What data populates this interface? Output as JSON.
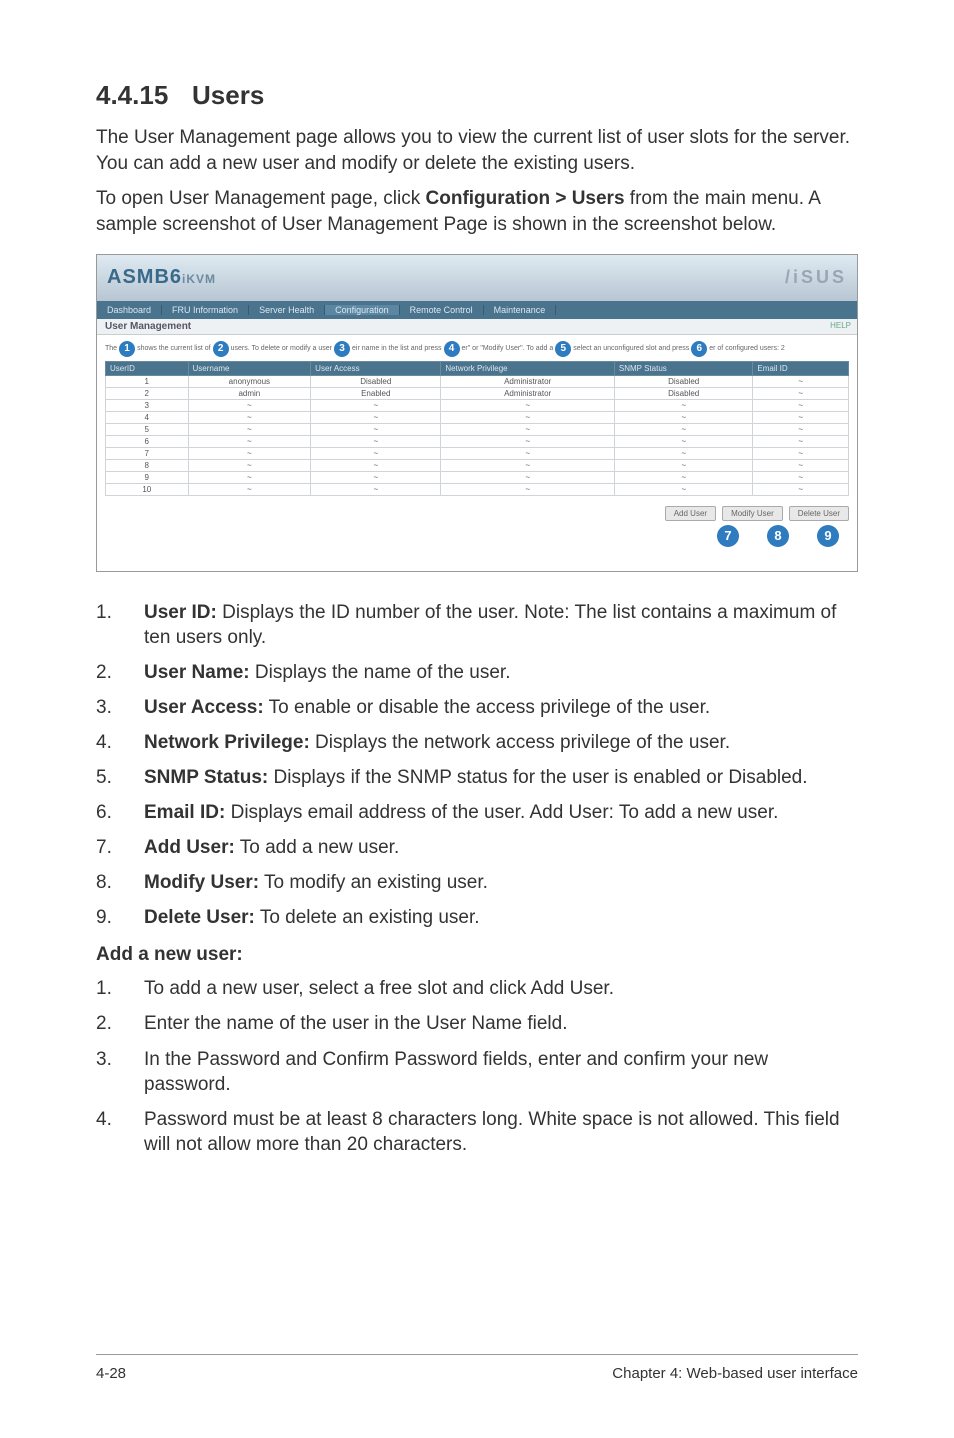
{
  "section_number": "4.4.15",
  "section_title": "Users",
  "intro_p1": "The User Management page allows you to view the current list of user slots for the server. You can add a new user and modify or delete the existing users.",
  "intro_p2_a": "To open User Management page, click ",
  "intro_p2_b": "Configuration > Users",
  "intro_p2_c": " from the main menu. A sample screenshot of User Management Page is shown in the screenshot below.",
  "shot": {
    "brand": "ASMB6",
    "brand_suffix": "iKVM",
    "logo": "/iSUS",
    "tabs": [
      "Dashboard",
      "FRU Information",
      "Server Health",
      "Configuration",
      "Remote Control",
      "Maintenance"
    ],
    "page_title": "User Management",
    "help": "HELP",
    "instr": {
      "a": "The",
      "b": "shows the current list of",
      "c": "users. To delete or modify a user",
      "d": "eir name in the list and press",
      "e": "er\" or \"Modify User\". To add a",
      "f": "select an unconfigured slot and press",
      "g": "er of configured users: 2"
    },
    "cols": [
      "UserID",
      "Username",
      "User Access",
      "Network Privilege",
      "SNMP Status",
      "Email ID"
    ],
    "rows": [
      {
        "id": "1",
        "name": "anonymous",
        "acc": "Disabled",
        "np": "Administrator",
        "snmp": "Disabled",
        "email": "~"
      },
      {
        "id": "2",
        "name": "admin",
        "acc": "Enabled",
        "np": "Administrator",
        "snmp": "Disabled",
        "email": "~"
      },
      {
        "id": "3",
        "name": "~",
        "acc": "~",
        "np": "~",
        "snmp": "~",
        "email": "~"
      },
      {
        "id": "4",
        "name": "~",
        "acc": "~",
        "np": "~",
        "snmp": "~",
        "email": "~"
      },
      {
        "id": "5",
        "name": "~",
        "acc": "~",
        "np": "~",
        "snmp": "~",
        "email": "~"
      },
      {
        "id": "6",
        "name": "~",
        "acc": "~",
        "np": "~",
        "snmp": "~",
        "email": "~"
      },
      {
        "id": "7",
        "name": "~",
        "acc": "~",
        "np": "~",
        "snmp": "~",
        "email": "~"
      },
      {
        "id": "8",
        "name": "~",
        "acc": "~",
        "np": "~",
        "snmp": "~",
        "email": "~"
      },
      {
        "id": "9",
        "name": "~",
        "acc": "~",
        "np": "~",
        "snmp": "~",
        "email": "~"
      },
      {
        "id": "10",
        "name": "~",
        "acc": "~",
        "np": "~",
        "snmp": "~",
        "email": "~"
      }
    ],
    "buttons": {
      "add": "Add User",
      "modify": "Modify User",
      "delete": "Delete User"
    },
    "callouts": {
      "c1": "1",
      "c2": "2",
      "c3": "3",
      "c4": "4",
      "c5": "5",
      "c6": "6",
      "c7": "7",
      "c8": "8",
      "c9": "9"
    }
  },
  "legend": [
    {
      "n": "1.",
      "label": "User ID:",
      "text": " Displays the ID number of the user. Note: The list contains a maximum of ten users only."
    },
    {
      "n": "2.",
      "label": "User Name:",
      "text": " Displays the name of the user."
    },
    {
      "n": "3.",
      "label": "User Access:",
      "text": " To enable or disable the access privilege of the user."
    },
    {
      "n": "4.",
      "label": "Network Privilege:",
      "text": " Displays the network access privilege of the user."
    },
    {
      "n": "5.",
      "label": "SNMP Status:",
      "text": " Displays if the SNMP status for the user is enabled or Disabled."
    },
    {
      "n": "6.",
      "label": "Email ID:",
      "text": " Displays email address of the user. Add User: To add a new user."
    },
    {
      "n": "7.",
      "label": "Add User:",
      "text": " To add a new user."
    },
    {
      "n": "8.",
      "label": "Modify User:",
      "text": " To modify an existing user."
    },
    {
      "n": "9.",
      "label": "Delete User:",
      "text": " To delete an existing user."
    }
  ],
  "add_heading": "Add a new user:",
  "add_steps": [
    {
      "n": "1.",
      "text": "To add a new user, select a free slot and click Add User."
    },
    {
      "n": "2.",
      "text": "Enter the name of the user in the User Name field."
    },
    {
      "n": "3.",
      "text": "In the Password and Confirm Password fields, enter and confirm your new password."
    },
    {
      "n": "4.",
      "text": "Password must be at least 8 characters long. White space is not allowed. This field will not allow more than 20 characters."
    }
  ],
  "footer": {
    "left": "4-28",
    "right": "Chapter 4: Web-based user interface"
  }
}
